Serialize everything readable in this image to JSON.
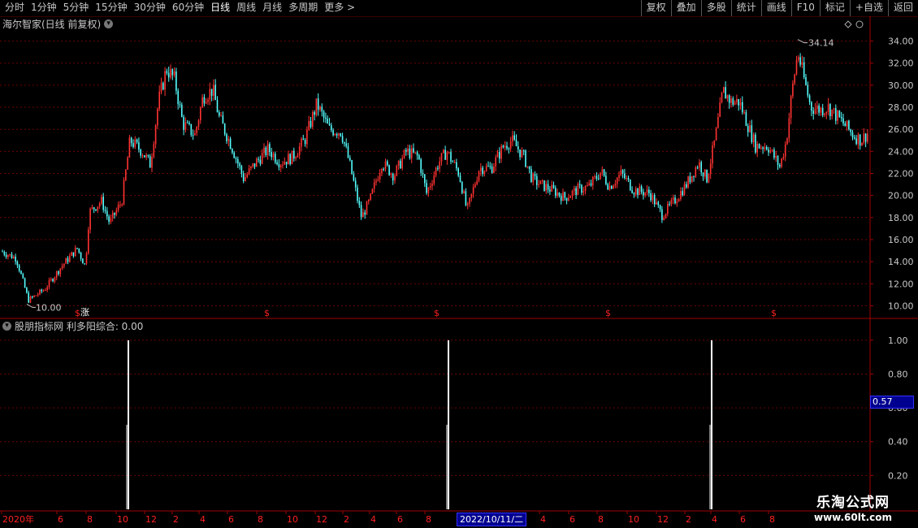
{
  "toolbar": {
    "periods": [
      "分时",
      "1分钟",
      "5分钟",
      "15分钟",
      "30分钟",
      "60分钟",
      "日线",
      "周线",
      "月线",
      "多周期",
      "更多 >"
    ],
    "active_period": "日线",
    "buttons": [
      "复权",
      "叠加",
      "多股",
      "统计",
      "画线",
      "F10",
      "标记",
      "+自选",
      "返回"
    ]
  },
  "main_title": "海尔智家(日线 前复权)",
  "indicator_title": "股朋指标网 利多阳综合: 0.00",
  "date_highlight": "2022/10/11/二",
  "cursor_value": "0.57",
  "watermark": {
    "title": "乐淘公式网",
    "url": "www.60lt.com"
  },
  "colors": {
    "up": "#ff3232",
    "down": "#54fcfc",
    "grid": "#6e0000",
    "axis": "#a00000",
    "signal": "#ffffff",
    "marker": "#ff2020"
  },
  "chart_data": [
    {
      "type": "candlestick",
      "title": "海尔智家(日线 前复权)",
      "ylim": [
        9.0,
        35.0
      ],
      "yticks": [
        "10.00",
        "12.00",
        "14.00",
        "16.00",
        "18.00",
        "20.00",
        "22.00",
        "24.00",
        "26.00",
        "28.00",
        "30.00",
        "32.00",
        "34.00"
      ],
      "high_label": "34.14",
      "low_label": "10.00",
      "path": [
        [
          0,
          15.0
        ],
        [
          20,
          14.3
        ],
        [
          35,
          10.5
        ],
        [
          55,
          11.5
        ],
        [
          75,
          13.5
        ],
        [
          95,
          15.2
        ],
        [
          105,
          13.6
        ],
        [
          110,
          18.5
        ],
        [
          125,
          19.5
        ],
        [
          135,
          17.5
        ],
        [
          150,
          19.5
        ],
        [
          160,
          25.0
        ],
        [
          175,
          24.0
        ],
        [
          185,
          22.8
        ],
        [
          195,
          28.5
        ],
        [
          205,
          31.5
        ],
        [
          215,
          30.5
        ],
        [
          225,
          26.5
        ],
        [
          240,
          25.5
        ],
        [
          250,
          29.0
        ],
        [
          262,
          29.6
        ],
        [
          270,
          27.0
        ],
        [
          285,
          24.5
        ],
        [
          300,
          21.5
        ],
        [
          315,
          23.0
        ],
        [
          330,
          24.2
        ],
        [
          345,
          23.0
        ],
        [
          360,
          23.5
        ],
        [
          375,
          25.0
        ],
        [
          390,
          28.3
        ],
        [
          405,
          26.0
        ],
        [
          420,
          25.8
        ],
        [
          430,
          23.0
        ],
        [
          445,
          18.0
        ],
        [
          455,
          19.5
        ],
        [
          470,
          23.0
        ],
        [
          485,
          21.8
        ],
        [
          500,
          24.0
        ],
        [
          515,
          23.5
        ],
        [
          525,
          20.2
        ],
        [
          540,
          23.0
        ],
        [
          550,
          24.0
        ],
        [
          565,
          22.0
        ],
        [
          575,
          18.6
        ],
        [
          590,
          22.5
        ],
        [
          605,
          22.5
        ],
        [
          620,
          24.5
        ],
        [
          630,
          25.0
        ],
        [
          645,
          23.5
        ],
        [
          655,
          21.5
        ],
        [
          665,
          21.0
        ],
        [
          680,
          20.5
        ],
        [
          695,
          19.8
        ],
        [
          710,
          20.5
        ],
        [
          725,
          20.8
        ],
        [
          740,
          22.2
        ],
        [
          750,
          20.8
        ],
        [
          765,
          22.0
        ],
        [
          780,
          20.5
        ],
        [
          800,
          20.2
        ],
        [
          815,
          18.2
        ],
        [
          830,
          19.5
        ],
        [
          845,
          21.0
        ],
        [
          860,
          23.0
        ],
        [
          870,
          21.5
        ],
        [
          880,
          25.0
        ],
        [
          890,
          29.5
        ],
        [
          900,
          28.5
        ],
        [
          910,
          28.5
        ],
        [
          920,
          26.5
        ],
        [
          930,
          24.5
        ],
        [
          945,
          24.5
        ],
        [
          960,
          22.6
        ],
        [
          968,
          25.0
        ],
        [
          975,
          29.5
        ],
        [
          982,
          33.0
        ],
        [
          990,
          30.5
        ],
        [
          998,
          28.0
        ],
        [
          1010,
          27.8
        ],
        [
          1020,
          28.0
        ],
        [
          1035,
          26.8
        ],
        [
          1050,
          25.5
        ],
        [
          1060,
          25.0
        ],
        [
          1070,
          25.8
        ]
      ],
      "markers": [
        {
          "x": 95,
          "label": "$"
        },
        {
          "x": 328,
          "label": "$"
        },
        {
          "x": 537,
          "label": "$"
        },
        {
          "x": 748,
          "label": "$"
        },
        {
          "x": 952,
          "label": "$"
        }
      ],
      "zhang_label": "涨"
    },
    {
      "type": "bar",
      "title": "股朋指标网 利多阳综合",
      "ylim": [
        0,
        1.1
      ],
      "yticks": [
        "0.20",
        "0.40",
        "0.60",
        "0.80",
        "1.00"
      ],
      "signals": [
        {
          "x": 158,
          "value": 1.0
        },
        {
          "x": 552,
          "value": 1.0
        },
        {
          "x": 876,
          "value": 1.0
        }
      ]
    }
  ],
  "xaxis_labels": [
    {
      "x": 2,
      "label": "2020年"
    },
    {
      "x": 70,
      "label": "6"
    },
    {
      "x": 106,
      "label": "8"
    },
    {
      "x": 143,
      "label": "10"
    },
    {
      "x": 178,
      "label": "12"
    },
    {
      "x": 212,
      "label": "2"
    },
    {
      "x": 245,
      "label": "4"
    },
    {
      "x": 280,
      "label": "6"
    },
    {
      "x": 316,
      "label": "8"
    },
    {
      "x": 352,
      "label": "10"
    },
    {
      "x": 388,
      "label": "12"
    },
    {
      "x": 422,
      "label": "2"
    },
    {
      "x": 455,
      "label": "4"
    },
    {
      "x": 488,
      "label": "6"
    },
    {
      "x": 523,
      "label": "8"
    },
    {
      "x": 664,
      "label": "4"
    },
    {
      "x": 700,
      "label": "6"
    },
    {
      "x": 735,
      "label": "8"
    },
    {
      "x": 772,
      "label": "10"
    },
    {
      "x": 808,
      "label": "12"
    },
    {
      "x": 843,
      "label": "2"
    },
    {
      "x": 875,
      "label": "4"
    },
    {
      "x": 910,
      "label": "6"
    },
    {
      "x": 946,
      "label": "8"
    }
  ]
}
